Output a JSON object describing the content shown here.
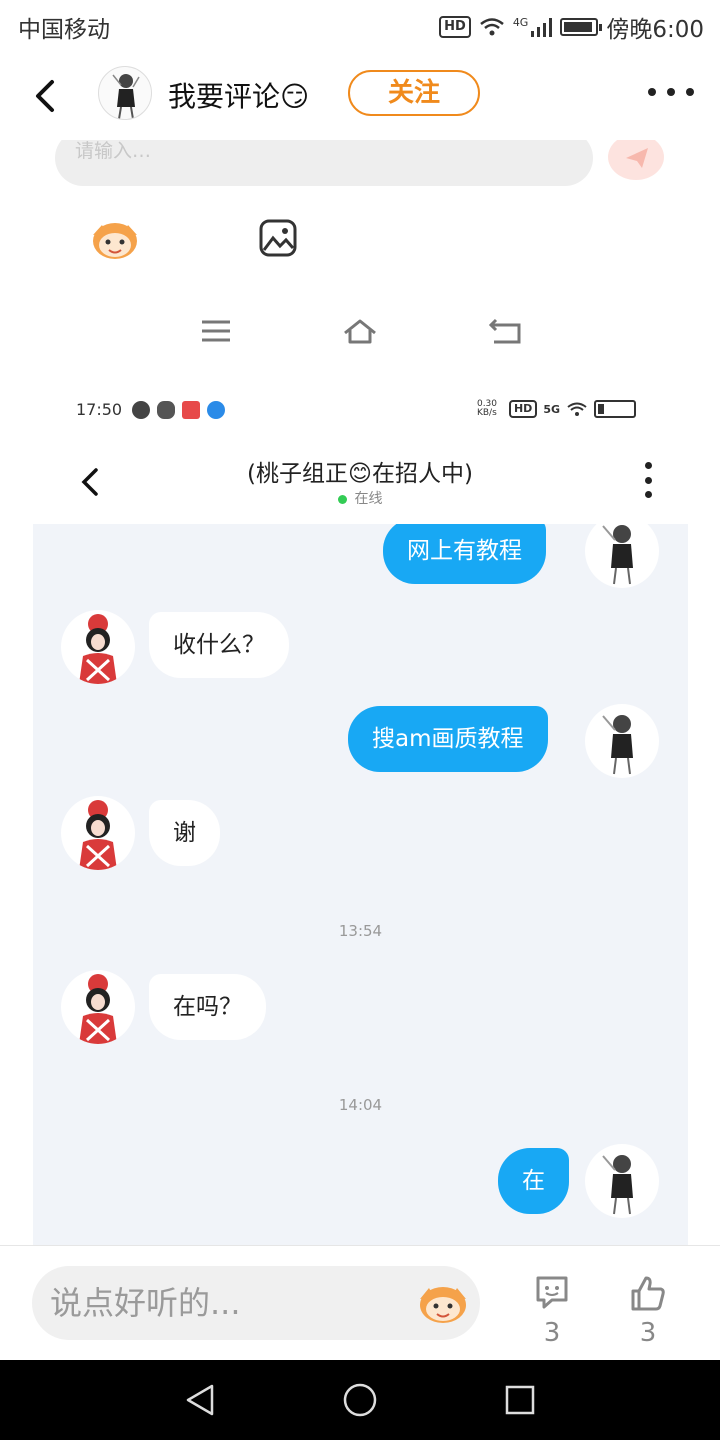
{
  "status_bar": {
    "carrier": "中国移动",
    "hd": "HD",
    "network": "4G",
    "time": "傍晚6:00"
  },
  "header": {
    "title": "我要评论😏",
    "follow_label": "关注"
  },
  "screenshot": {
    "old_input_placeholder": "请输入…",
    "inner_status": {
      "time": "17:50",
      "speed": "0.30 KB/s",
      "hd": "HD",
      "network": "5G"
    },
    "chat": {
      "name": "(桃子组正😊在招人中)",
      "online_status": "在线",
      "messages": [
        {
          "side": "right",
          "text": "网上有教程"
        },
        {
          "side": "left",
          "text": "收什么？"
        },
        {
          "side": "right",
          "text": "搜am画质教程"
        },
        {
          "side": "left",
          "text": "谢"
        },
        {
          "side": "time",
          "text": "13:54"
        },
        {
          "side": "left",
          "text": "在吗？"
        },
        {
          "side": "time",
          "text": "14:04"
        },
        {
          "side": "right",
          "text": "在"
        }
      ]
    }
  },
  "bottom_bar": {
    "comment_placeholder": "说点好听的...",
    "comment_count": "3",
    "like_count": "3"
  },
  "colors": {
    "accent_orange": "#f08a1c",
    "bubble_blue": "#18a8f4",
    "chat_bg": "#f1f4f9"
  },
  "icons": [
    "back-icon",
    "more-icon",
    "send-icon",
    "emoji-icon",
    "image-icon",
    "menu-icon",
    "home-icon",
    "return-icon",
    "comment-icon",
    "like-icon"
  ]
}
